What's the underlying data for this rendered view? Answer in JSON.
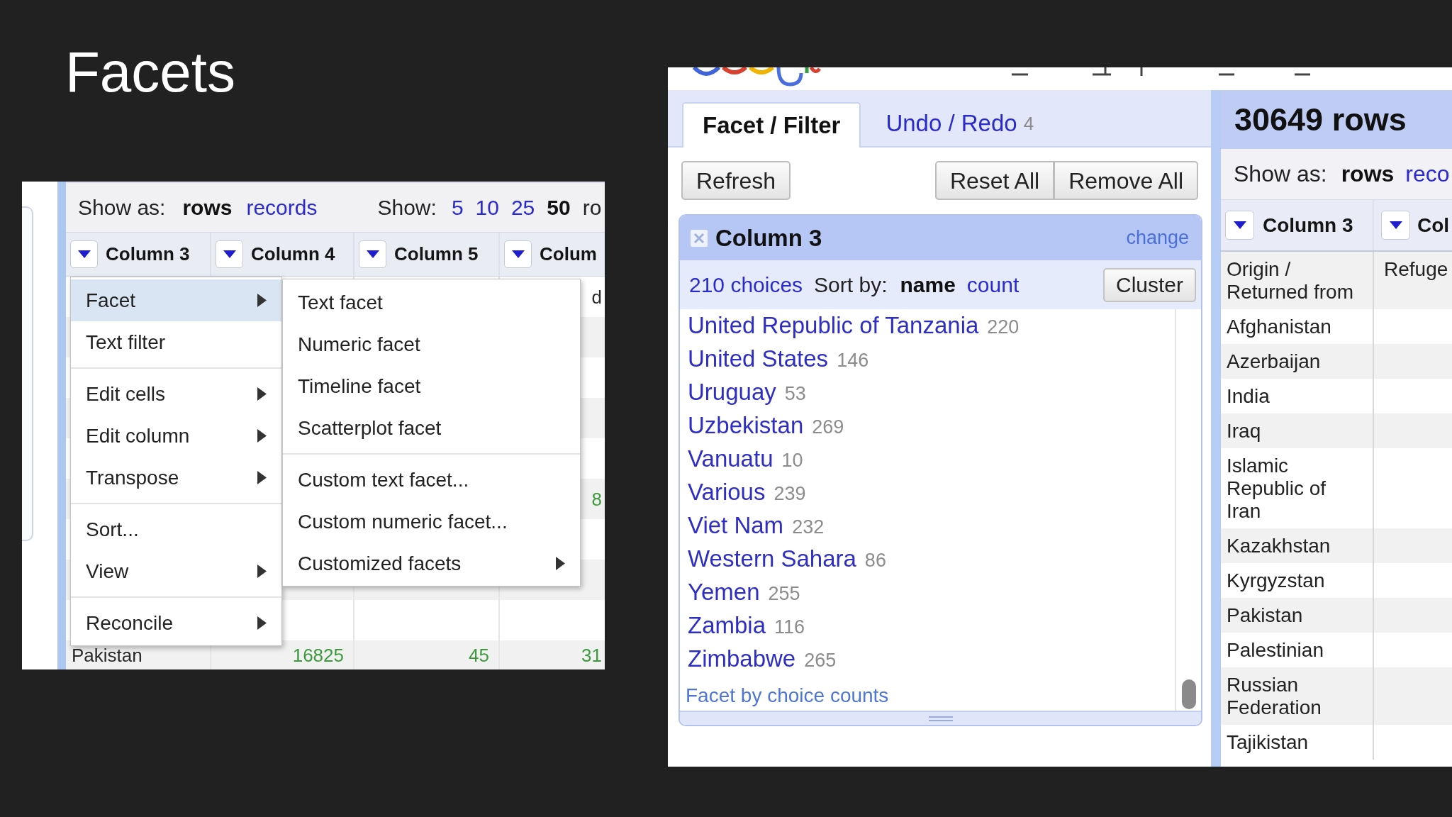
{
  "title": "Facets",
  "left_screenshot": {
    "show_as": {
      "label": "Show as:",
      "options": [
        {
          "label": "rows",
          "selected": true
        },
        {
          "label": "records",
          "selected": false
        }
      ]
    },
    "page_size": {
      "label": "Show:",
      "options": [
        {
          "label": "5",
          "selected": false
        },
        {
          "label": "10",
          "selected": false
        },
        {
          "label": "25",
          "selected": false
        },
        {
          "label": "50",
          "selected": true
        }
      ],
      "suffix": "ro"
    },
    "columns": [
      "Column 3",
      "Column 4",
      "Column 5",
      "Colum"
    ],
    "rows": [
      {
        "column_6": {
          "text": "d",
          "kind": "text"
        }
      },
      {
        "column_6": {
          "text": "8",
          "kind": "number"
        }
      },
      {
        "column_3": {
          "text": "Pakistan",
          "kind": "text"
        },
        "column_4": {
          "text": "16825",
          "kind": "number"
        },
        "column_5": {
          "text": "45",
          "kind": "number"
        },
        "column_6": {
          "text": "31",
          "kind": "number"
        }
      }
    ],
    "column_menu": {
      "groups": [
        {
          "items": [
            {
              "label": "Facet",
              "submenu": true,
              "selected": true
            },
            {
              "label": "Text filter",
              "submenu": false,
              "selected": false
            }
          ]
        },
        {
          "items": [
            {
              "label": "Edit cells",
              "submenu": true,
              "selected": false
            },
            {
              "label": "Edit column",
              "submenu": true,
              "selected": false
            },
            {
              "label": "Transpose",
              "submenu": true,
              "selected": false
            }
          ]
        },
        {
          "items": [
            {
              "label": "Sort...",
              "submenu": false,
              "selected": false
            },
            {
              "label": "View",
              "submenu": true,
              "selected": false
            }
          ]
        },
        {
          "items": [
            {
              "label": "Reconcile",
              "submenu": true,
              "selected": false
            }
          ]
        }
      ]
    },
    "facet_submenu": {
      "groups": [
        {
          "items": [
            {
              "label": "Text facet",
              "submenu": false,
              "selected": false
            },
            {
              "label": "Numeric facet",
              "submenu": false,
              "selected": false
            },
            {
              "label": "Timeline facet",
              "submenu": false,
              "selected": false
            },
            {
              "label": "Scatterplot facet",
              "submenu": false,
              "selected": false
            }
          ]
        },
        {
          "items": [
            {
              "label": "Custom text facet...",
              "submenu": false,
              "selected": false
            },
            {
              "label": "Custom numeric facet...",
              "submenu": false,
              "selected": false
            },
            {
              "label": "Customized facets",
              "submenu": true,
              "selected": false
            }
          ]
        }
      ]
    }
  },
  "right_screenshot": {
    "tabs": [
      {
        "label": "Facet / Filter",
        "selected": true
      },
      {
        "label": "Undo / Redo",
        "count": "4",
        "selected": false
      }
    ],
    "buttons_left": [
      "Refresh"
    ],
    "buttons_right": [
      "Reset All",
      "Remove All"
    ],
    "facet": {
      "title": "Column 3",
      "action": "change",
      "choices": "210 choices",
      "sort_label": "Sort by:",
      "sort_options": [
        {
          "label": "name",
          "selected": true
        },
        {
          "label": "count",
          "selected": false
        }
      ],
      "cluster_button": "Cluster",
      "items": [
        {
          "name": "United Republic of Tanzania",
          "count": "220"
        },
        {
          "name": "United States",
          "count": "146"
        },
        {
          "name": "Uruguay",
          "count": "53"
        },
        {
          "name": "Uzbekistan",
          "count": "269"
        },
        {
          "name": "Vanuatu",
          "count": "10"
        },
        {
          "name": "Various",
          "count": "239"
        },
        {
          "name": "Viet Nam",
          "count": "232"
        },
        {
          "name": "Western Sahara",
          "count": "86"
        },
        {
          "name": "Yemen",
          "count": "255"
        },
        {
          "name": "Zambia",
          "count": "116"
        },
        {
          "name": "Zimbabwe",
          "count": "265"
        }
      ],
      "footer_link": "Facet by choice counts"
    },
    "data": {
      "row_count": "30649 rows",
      "show_as": {
        "label": "Show as:",
        "options": [
          {
            "label": "rows",
            "selected": true
          },
          {
            "label": "reco",
            "selected": false
          }
        ]
      },
      "columns": [
        "Column 3",
        "Col"
      ],
      "rows": [
        {
          "cells": [
            "Origin / Returned from",
            "Refuge"
          ]
        },
        {
          "cells": [
            "Afghanistan"
          ]
        },
        {
          "cells": [
            "Azerbaijan"
          ]
        },
        {
          "cells": [
            "India"
          ]
        },
        {
          "cells": [
            "Iraq"
          ]
        },
        {
          "cells": [
            "Islamic Republic of Iran"
          ]
        },
        {
          "cells": [
            "Kazakhstan"
          ]
        },
        {
          "cells": [
            "Kyrgyzstan"
          ]
        },
        {
          "cells": [
            "Pakistan"
          ]
        },
        {
          "cells": [
            "Palestinian"
          ]
        },
        {
          "cells": [
            "Russian Federation"
          ]
        },
        {
          "cells": [
            "Tajikistan"
          ]
        }
      ]
    }
  }
}
